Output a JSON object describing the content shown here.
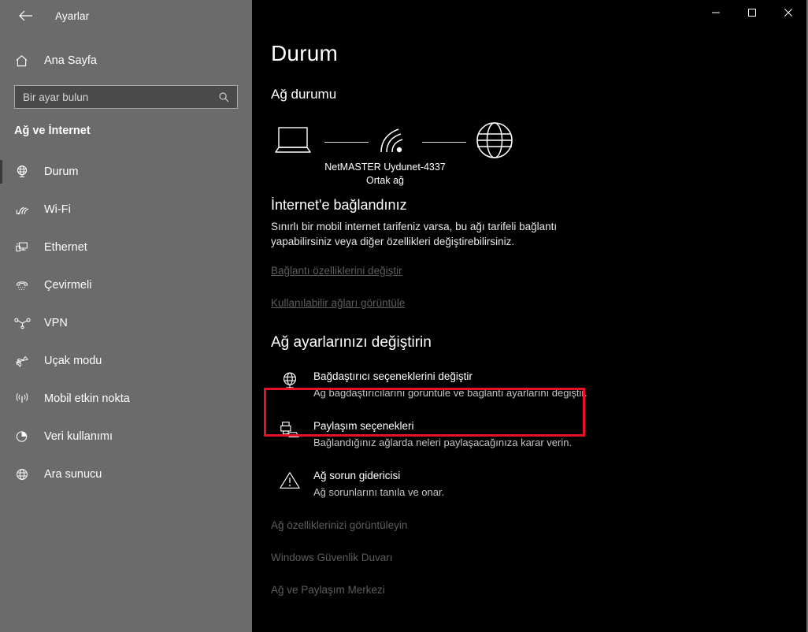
{
  "window": {
    "app_title": "Ayarlar",
    "back_icon": "back-arrow-icon",
    "minimize_label": "─",
    "maximize_label": "□",
    "close_label": "✕"
  },
  "sidebar": {
    "home_label": "Ana Sayfa",
    "home_icon": "home-icon",
    "search": {
      "placeholder": "Bir ayar bulun",
      "value": "",
      "icon": "search-icon"
    },
    "category_header": "Ağ ve İnternet",
    "items": [
      {
        "label": "Durum",
        "icon": "status-globe-icon",
        "selected": true
      },
      {
        "label": "Wi-Fi",
        "icon": "wifi-icon",
        "selected": false
      },
      {
        "label": "Ethernet",
        "icon": "ethernet-icon",
        "selected": false
      },
      {
        "label": "Çevirmeli",
        "icon": "dialup-phone-icon",
        "selected": false
      },
      {
        "label": "VPN",
        "icon": "vpn-icon",
        "selected": false
      },
      {
        "label": "Uçak modu",
        "icon": "airplane-icon",
        "selected": false
      },
      {
        "label": "Mobil etkin nokta",
        "icon": "hotspot-icon",
        "selected": false
      },
      {
        "label": "Veri kullanımı",
        "icon": "data-usage-pie-icon",
        "selected": false
      },
      {
        "label": "Ara sunucu",
        "icon": "proxy-globe-icon",
        "selected": false
      }
    ]
  },
  "main": {
    "page_title": "Durum",
    "network_status_header": "Ağ durumu",
    "diagram": {
      "device_icon": "laptop-icon",
      "link_icon": "wifi-signal-icon",
      "internet_icon": "globe-icon",
      "network_name": "NetMASTER Uydunet-4337",
      "network_type": "Ortak ağ"
    },
    "connection_title": "İnternet'e bağlandınız",
    "connection_desc": "Sınırlı bir mobil internet tarifeniz varsa, bu ağı tarifeli bağlantı yapabilirsiniz veya diğer özellikleri değiştirebilirsiniz.",
    "link_change_connection": "Bağlantı özelliklerini değiştir",
    "link_show_networks": "Kullanılabilir ağları görüntüle",
    "change_settings_header": "Ağ ayarlarınızı değiştirin",
    "options": [
      {
        "title": "Bağdaştırıcı seçeneklerini değiştir",
        "subtitle": "Ağ bağdaştırıcılarını görüntüle ve bağlantı ayarlarını değiştir.",
        "icon": "adapter-globe-monitor-icon",
        "highlighted": true
      },
      {
        "title": "Paylaşım seçenekleri",
        "subtitle": "Bağlandığınız ağlarda neleri paylaşacağınıza karar verin.",
        "icon": "printer-folder-share-icon",
        "highlighted": false
      },
      {
        "title": "Ağ sorun gidericisi",
        "subtitle": "Ağ sorunlarını tanıla ve onar.",
        "icon": "warning-triangle-icon",
        "highlighted": false
      }
    ],
    "bottom_links": [
      "Ağ özelliklerinizi görüntüleyin",
      "Windows Güvenlik Duvarı",
      "Ağ ve Paylaşım Merkezi"
    ]
  },
  "colors": {
    "sidebar_bg": "#6b6b6b",
    "main_bg": "#000000",
    "highlight_red": "#e81123",
    "dim_link": "#5d5d5d"
  }
}
